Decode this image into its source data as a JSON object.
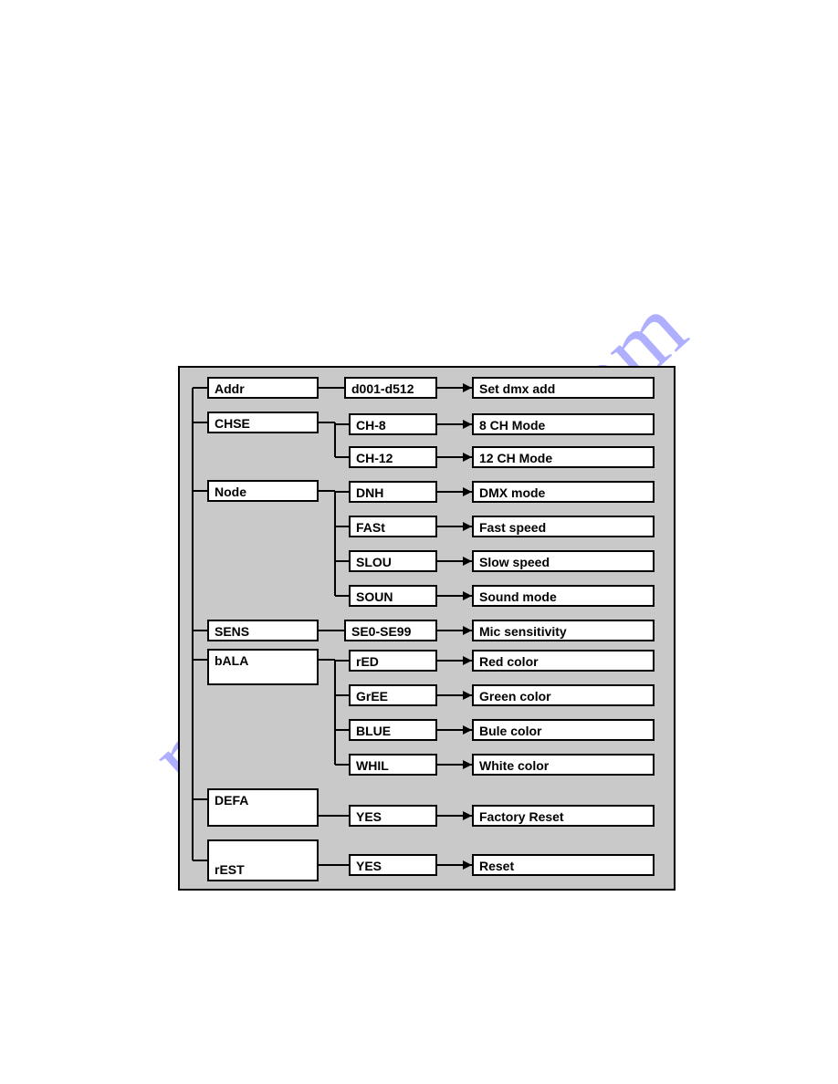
{
  "watermark": "manualshive.com",
  "menu": {
    "addr": {
      "col1": "Addr",
      "col2": "d001-d512",
      "col3": "Set dmx add"
    },
    "chse": {
      "col1": "CHSE",
      "opt1": {
        "col2": "CH-8",
        "col3": "8 CH Mode"
      },
      "opt2": {
        "col2": "CH-12",
        "col3": "12 CH Mode"
      }
    },
    "node": {
      "col1": "Node",
      "opt1": {
        "col2": "DNH",
        "col3": "DMX mode"
      },
      "opt2": {
        "col2": "FASt",
        "col3": "Fast speed"
      },
      "opt3": {
        "col2": "SLOU",
        "col3": "Slow speed"
      },
      "opt4": {
        "col2": "SOUN",
        "col3": "Sound mode"
      }
    },
    "sens": {
      "col1": "SENS",
      "col2": "SE0-SE99",
      "col3": "Mic sensitivity"
    },
    "bala": {
      "col1": "bALA",
      "opt1": {
        "col2": "rED",
        "col3": "Red color"
      },
      "opt2": {
        "col2": "GrEE",
        "col3": "Green color"
      },
      "opt3": {
        "col2": "BLUE",
        "col3": "Bule color"
      },
      "opt4": {
        "col2": "WHIL",
        "col3": "White color"
      }
    },
    "defa": {
      "col1": "DEFA",
      "col2": "YES",
      "col3": "Factory Reset"
    },
    "rest": {
      "col1": "rEST",
      "col2": "YES",
      "col3": "Reset"
    }
  }
}
